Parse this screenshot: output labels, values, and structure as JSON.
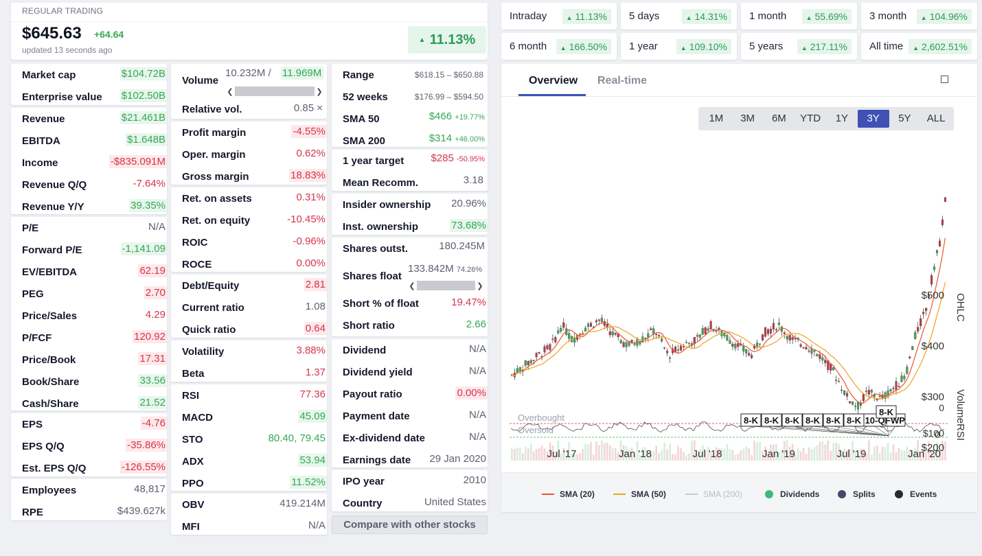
{
  "quote": {
    "trading_status": "REGULAR TRADING",
    "price": "$645.63",
    "change": "+64.64",
    "updated": "updated 13 seconds ago",
    "change_pct": "11.13%"
  },
  "performance": [
    {
      "label": "Intraday",
      "value": "11.13%"
    },
    {
      "label": "5 days",
      "value": "14.31%"
    },
    {
      "label": "1 month",
      "value": "55.69%"
    },
    {
      "label": "3 month",
      "value": "104.96%"
    },
    {
      "label": "6 month",
      "value": "166.50%"
    },
    {
      "label": "1 year",
      "value": "109.10%"
    },
    {
      "label": "5 years",
      "value": "217.11%"
    },
    {
      "label": "All time",
      "value": "2,602.51%"
    }
  ],
  "col1": {
    "g1": [
      {
        "label": "Market cap",
        "value": "$104.72B",
        "tone": "gb"
      },
      {
        "label": "Enterprise value",
        "value": "$102.50B",
        "tone": "gb"
      }
    ],
    "g2": [
      {
        "label": "Revenue",
        "value": "$21.461B",
        "tone": "gb"
      },
      {
        "label": "EBITDA",
        "value": "$1.648B",
        "tone": "gb"
      },
      {
        "label": "Income",
        "value": "-$835.091M",
        "tone": "rb"
      },
      {
        "label": "Revenue Q/Q",
        "value": "-7.64%",
        "tone": "r"
      },
      {
        "label": "Revenue Y/Y",
        "value": "39.35%",
        "tone": "gb"
      }
    ],
    "g3": [
      {
        "label": "P/E",
        "value": "N/A",
        "tone": "n"
      },
      {
        "label": "Forward P/E",
        "value": "-1,141.09",
        "tone": "gb"
      },
      {
        "label": "EV/EBITDA",
        "value": "62.19",
        "tone": "rb"
      },
      {
        "label": "PEG",
        "value": "2.70",
        "tone": "rb"
      },
      {
        "label": "Price/Sales",
        "value": "4.29",
        "tone": "r"
      },
      {
        "label": "P/FCF",
        "value": "120.92",
        "tone": "rb"
      },
      {
        "label": "Price/Book",
        "value": "17.31",
        "tone": "rb"
      },
      {
        "label": "Book/Share",
        "value": "33.56",
        "tone": "gb"
      },
      {
        "label": "Cash/Share",
        "value": "21.52",
        "tone": "gb"
      }
    ],
    "g4": [
      {
        "label": "EPS",
        "value": "-4.76",
        "tone": "rb"
      },
      {
        "label": "EPS Q/Q",
        "value": "-35.86%",
        "tone": "rb"
      },
      {
        "label": "Est. EPS Q/Q",
        "value": "-126.55%",
        "tone": "rb"
      }
    ],
    "g5": [
      {
        "label": "Employees",
        "value": "48,817",
        "tone": "n"
      },
      {
        "label": "RPE",
        "value": "$439.627k",
        "tone": "n"
      }
    ]
  },
  "col2": {
    "volume": {
      "label": "Volume",
      "value": "10.232M /",
      "avg": "11.969M"
    },
    "relvol": {
      "label": "Relative vol.",
      "value": "0.85 ×"
    },
    "g2": [
      {
        "label": "Profit margin",
        "value": "-4.55%",
        "tone": "rb"
      },
      {
        "label": "Oper. margin",
        "value": "0.62%",
        "tone": "r"
      },
      {
        "label": "Gross margin",
        "value": "18.83%",
        "tone": "rb"
      }
    ],
    "g3": [
      {
        "label": "Ret. on assets",
        "value": "0.31%",
        "tone": "r"
      },
      {
        "label": "Ret. on equity",
        "value": "-10.45%",
        "tone": "r"
      },
      {
        "label": "ROIC",
        "value": "-0.96%",
        "tone": "r"
      },
      {
        "label": "ROCE",
        "value": "0.00%",
        "tone": "r"
      }
    ],
    "g4": [
      {
        "label": "Debt/Equity",
        "value": "2.81",
        "tone": "rb"
      },
      {
        "label": "Current ratio",
        "value": "1.08",
        "tone": "n"
      },
      {
        "label": "Quick ratio",
        "value": "0.64",
        "tone": "rb"
      }
    ],
    "g5": [
      {
        "label": "Volatility",
        "value": "3.88%",
        "tone": "r"
      },
      {
        "label": "Beta",
        "value": "1.37",
        "tone": "r"
      }
    ],
    "g6": [
      {
        "label": "RSI",
        "value": "77.36",
        "tone": "r"
      },
      {
        "label": "MACD",
        "value": "45.09",
        "tone": "gb"
      },
      {
        "label": "STO",
        "value": "80.40, 79.45",
        "tone": "g"
      },
      {
        "label": "ADX",
        "value": "53.94",
        "tone": "gb"
      },
      {
        "label": "PPO",
        "value": "11.52%",
        "tone": "gb"
      }
    ],
    "g7": [
      {
        "label": "OBV",
        "value": "419.214M",
        "tone": "n"
      },
      {
        "label": "MFI",
        "value": "N/A",
        "tone": "n"
      }
    ]
  },
  "col3": {
    "range": {
      "label": "Range",
      "value": "$618.15 – $650.88"
    },
    "weeks52": {
      "label": "52 weeks",
      "value": "$176.99 – $594.50"
    },
    "sma50": {
      "label": "SMA 50",
      "value": "$466",
      "pct": "+19.77%"
    },
    "sma200": {
      "label": "SMA 200",
      "value": "$314",
      "pct": "+46.00%"
    },
    "target": {
      "label": "1 year target",
      "value": "$285",
      "pct": "-50.95%"
    },
    "recomm": {
      "label": "Mean Recomm.",
      "value": "3.18"
    },
    "g3": [
      {
        "label": "Insider ownership",
        "value": "20.96%",
        "tone": "n"
      },
      {
        "label": "Inst. ownership",
        "value": "73.68%",
        "tone": "gb"
      }
    ],
    "outst": {
      "label": "Shares outst.",
      "value": "180.245M"
    },
    "float": {
      "label": "Shares float",
      "value": "133.842M",
      "pct": "74.26%"
    },
    "g4b": [
      {
        "label": "Short % of float",
        "value": "19.47%",
        "tone": "r"
      },
      {
        "label": "Short ratio",
        "value": "2.66",
        "tone": "g"
      }
    ],
    "g5": [
      {
        "label": "Dividend",
        "value": "N/A",
        "tone": "n"
      },
      {
        "label": "Dividend yield",
        "value": "N/A",
        "tone": "n"
      },
      {
        "label": "Payout ratio",
        "value": "0.00%",
        "tone": "rb"
      },
      {
        "label": "Payment date",
        "value": "N/A",
        "tone": "n"
      },
      {
        "label": "Ex-dividend date",
        "value": "N/A",
        "tone": "n"
      },
      {
        "label": "Earnings date",
        "value": "29 Jan 2020",
        "tone": "n"
      }
    ],
    "g6": [
      {
        "label": "IPO year",
        "value": "2010",
        "tone": "n"
      },
      {
        "label": "Country",
        "value": "United States",
        "tone": "n"
      }
    ],
    "compare": "Compare with other stocks"
  },
  "chart": {
    "tabs": [
      "Overview",
      "Real-time"
    ],
    "ranges": [
      "1M",
      "3M",
      "6M",
      "YTD",
      "1Y",
      "3Y",
      "5Y",
      "ALL"
    ],
    "active_range": "3Y",
    "y_ticks": [
      "$500",
      "$400",
      "$300",
      "$200"
    ],
    "x_ticks": [
      "Jul '17",
      "Jan '18",
      "Jul '18",
      "Jan '19",
      "Jul '19",
      "Jan '20"
    ],
    "axis_ohlc": "OHLC",
    "axis_volume": "Volume",
    "axis_rsi": "RSI",
    "volume_zero": "0",
    "rsi_ticks": [
      "$100",
      "0"
    ],
    "overbought": "Overbought",
    "oversold": "Oversold",
    "events": [
      "8-K",
      "8-K",
      "8-K",
      "8-K",
      "8-K",
      "8-K",
      "10-Q",
      "FWP",
      "8-K"
    ],
    "legend": [
      {
        "label": "SMA (20)",
        "color": "#e8572a",
        "kind": "line"
      },
      {
        "label": "SMA (50)",
        "color": "#f0a020",
        "kind": "line"
      },
      {
        "label": "SMA (200)",
        "color": "#c8c8c8",
        "kind": "line"
      },
      {
        "label": "Dividends",
        "color": "#3dbb7a",
        "kind": "dot"
      },
      {
        "label": "Splits",
        "color": "#454a66",
        "kind": "dot"
      },
      {
        "label": "Events",
        "color": "#2a2a2a",
        "kind": "dot"
      }
    ]
  },
  "colors": {
    "up": "#3aa85a",
    "down": "#c0394b",
    "accent": "#3f51b5"
  }
}
